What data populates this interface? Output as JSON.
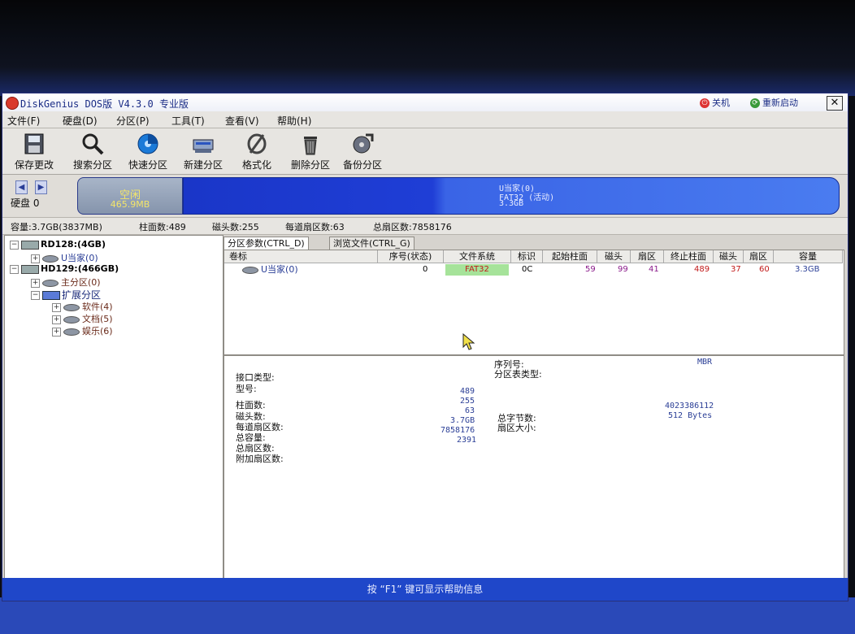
{
  "window": {
    "title": "DiskGenius DOS版 V4.3.0 专业版",
    "shutdown": "关机",
    "restart": "重新启动",
    "close": "✕"
  },
  "menu": [
    "文件(F)",
    "硬盘(D)",
    "分区(P)",
    "工具(T)",
    "查看(V)",
    "帮助(H)"
  ],
  "toolbar": [
    {
      "label": "保存更改",
      "icon": "save-icon"
    },
    {
      "label": "搜索分区",
      "icon": "search-icon"
    },
    {
      "label": "快速分区",
      "icon": "quick-partition-icon"
    },
    {
      "label": "新建分区",
      "icon": "new-partition-icon"
    },
    {
      "label": "格式化",
      "icon": "format-icon"
    },
    {
      "label": "删除分区",
      "icon": "delete-icon"
    },
    {
      "label": "备份分区",
      "icon": "backup-icon"
    }
  ],
  "diskmap": {
    "disk_label": "硬盘 0",
    "free_label": "空闲",
    "free_size": "465.9MB",
    "part_name": "U当家(0)",
    "part_fs": "FAT32 (活动)",
    "part_size": "3.3GB"
  },
  "diskinfo": {
    "capacity": "容量:3.7GB(3837MB)",
    "cylinders": "柱面数:489",
    "heads": "磁头数:255",
    "sectors_per_track": "每道扇区数:63",
    "total_sectors": "总扇区数:7858176"
  },
  "tree": {
    "disk0": "RD128:(4GB)",
    "disk0_part": "U当家(0)",
    "disk1": "HD129:(466GB)",
    "primary": "主分区(0)",
    "extended": "扩展分区",
    "logical": [
      "软件(4)",
      "文档(5)",
      "娱乐(6)"
    ]
  },
  "tabs": [
    "分区参数(CTRL_D)",
    "浏览文件(CTRL_G)"
  ],
  "table": {
    "headers": [
      "卷标",
      "序号(状态)",
      "文件系统",
      "标识",
      "起始柱面",
      "磁头",
      "扇区",
      "终止柱面",
      "磁头",
      "扇区",
      "容量"
    ],
    "row": {
      "label": "U当家(0)",
      "index": "0",
      "fs": "FAT32",
      "id": "0C",
      "start_cyl": "59",
      "start_head": "99",
      "start_sector": "41",
      "end_cyl": "489",
      "end_head": "37",
      "end_sector": "60",
      "size": "3.3GB"
    }
  },
  "details": {
    "labels_left": [
      "接口类型:",
      "型号:",
      "柱面数:",
      "磁头数:",
      "每道扇区数:",
      "总容量:",
      "总扇区数:",
      "附加扇区数:"
    ],
    "values_left": [
      "489",
      "255",
      "63",
      "3.7GB",
      "7858176",
      "2391"
    ],
    "labels_right": [
      "序列号:",
      "分区表类型:",
      "总字节数:",
      "扇区大小:"
    ],
    "partition_table_type": "MBR",
    "total_bytes": "4023386112",
    "sector_size": "512 Bytes"
  },
  "status": "按 “F1” 键可显示帮助信息"
}
